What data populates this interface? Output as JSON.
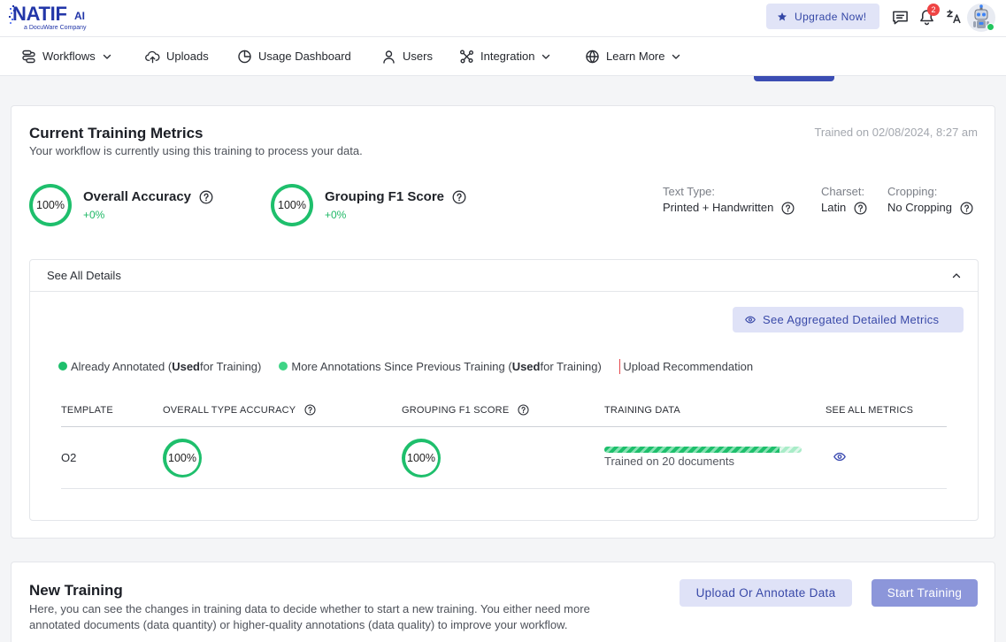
{
  "app": {
    "logo_name": "NATIF",
    "logo_suffix": "AI",
    "logo_tagline": "a DocuWare Company"
  },
  "header": {
    "upgrade_label": "Upgrade Now!",
    "upgrade_icon": "star-icon",
    "icons": [
      "chat-icon",
      "bell-icon",
      "translate-icon",
      "avatar"
    ],
    "notification_count": "2"
  },
  "nav": {
    "items": [
      {
        "label": "Workflows",
        "icon": "workflow-icon",
        "has_dropdown": true
      },
      {
        "label": "Uploads",
        "icon": "upload-cloud-icon",
        "has_dropdown": false
      },
      {
        "label": "Usage Dashboard",
        "icon": "usage-dashboard-icon",
        "has_dropdown": false
      },
      {
        "label": "Users",
        "icon": "user-icon",
        "has_dropdown": false
      },
      {
        "label": "Integration",
        "icon": "integration-icon",
        "has_dropdown": true
      },
      {
        "label": "Learn More",
        "icon": "globe-icon",
        "has_dropdown": true
      }
    ]
  },
  "training": {
    "title": "Current Training Metrics",
    "subtitle": "Your workflow is currently using this training to process your data.",
    "trained_on": "Trained on 02/08/2024, 8:27 am",
    "metrics": [
      {
        "value": "100%",
        "label": "Overall Accuracy",
        "delta": "+0%"
      },
      {
        "value": "100%",
        "label": "Grouping F1 Score",
        "delta": "+0%"
      }
    ],
    "properties": [
      {
        "label": "Text Type:",
        "value": "Printed + Handwritten"
      },
      {
        "label": "Charset:",
        "value": "Latin"
      },
      {
        "label": "Cropping:",
        "value": "No Cropping"
      }
    ],
    "details": {
      "toggle_label": "See All Details",
      "expanded": true,
      "aggregated_button": "See Aggregated Detailed Metrics",
      "legend": [
        {
          "text_before": "Already Annotated (",
          "text_bold": "Used",
          "text_after": " for Training)",
          "color": "#1ebf6c"
        },
        {
          "text_before": "More Annotations Since Previous Training (",
          "text_bold": "Used",
          "text_after": " for Training)",
          "color": "#3fd486"
        },
        {
          "text": "Upload Recommendation",
          "color": "#e5484d"
        }
      ],
      "table": {
        "headers": [
          "TEMPLATE",
          "OVERALL TYPE ACCURACY",
          "GROUPING F1 SCORE",
          "TRAINING DATA",
          "SEE ALL METRICS"
        ],
        "rows": [
          {
            "template": "O2",
            "overall_type_accuracy": "100%",
            "grouping_f1_score": "100%",
            "training_data": "Trained on 20 documents",
            "training_progress": {
              "annotated": 0.89,
              "new_annotations": 0.11
            }
          }
        ]
      }
    }
  },
  "new_training": {
    "title": "New Training",
    "description": "Here, you can see the changes in training data to decide whether to start a new training. You either need more annotated documents (data quantity) or higher-quality annotations (data quality) to improve your workflow.",
    "upload_button": "Upload Or Annotate Data",
    "start_button": "Start Training"
  },
  "colors": {
    "brand": "#2236a8",
    "accent": "#3949a8",
    "success": "#1ebf6c",
    "danger": "#e5484d",
    "soft_button_bg": "#dfe2f7",
    "disabled_button_bg": "#8c96da"
  }
}
